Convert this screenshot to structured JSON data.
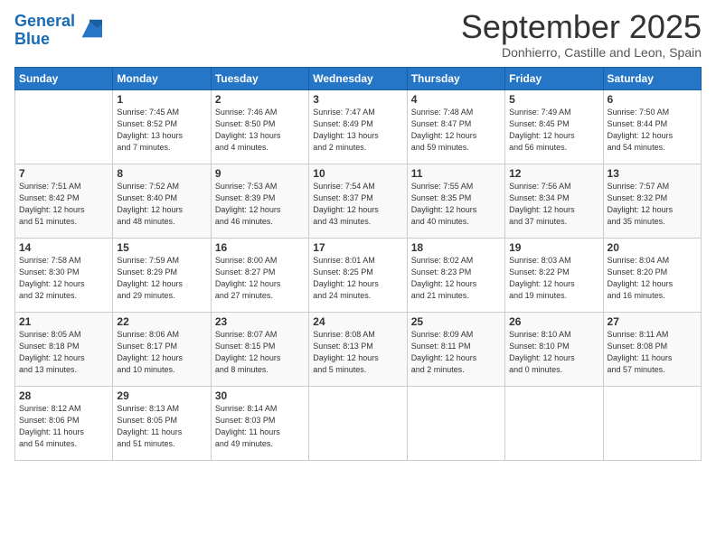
{
  "header": {
    "logo_line1": "General",
    "logo_line2": "Blue",
    "month": "September 2025",
    "location": "Donhierro, Castille and Leon, Spain"
  },
  "days_of_week": [
    "Sunday",
    "Monday",
    "Tuesday",
    "Wednesday",
    "Thursday",
    "Friday",
    "Saturday"
  ],
  "weeks": [
    [
      {
        "day": "",
        "info": ""
      },
      {
        "day": "1",
        "info": "Sunrise: 7:45 AM\nSunset: 8:52 PM\nDaylight: 13 hours\nand 7 minutes."
      },
      {
        "day": "2",
        "info": "Sunrise: 7:46 AM\nSunset: 8:50 PM\nDaylight: 13 hours\nand 4 minutes."
      },
      {
        "day": "3",
        "info": "Sunrise: 7:47 AM\nSunset: 8:49 PM\nDaylight: 13 hours\nand 2 minutes."
      },
      {
        "day": "4",
        "info": "Sunrise: 7:48 AM\nSunset: 8:47 PM\nDaylight: 12 hours\nand 59 minutes."
      },
      {
        "day": "5",
        "info": "Sunrise: 7:49 AM\nSunset: 8:45 PM\nDaylight: 12 hours\nand 56 minutes."
      },
      {
        "day": "6",
        "info": "Sunrise: 7:50 AM\nSunset: 8:44 PM\nDaylight: 12 hours\nand 54 minutes."
      }
    ],
    [
      {
        "day": "7",
        "info": "Sunrise: 7:51 AM\nSunset: 8:42 PM\nDaylight: 12 hours\nand 51 minutes."
      },
      {
        "day": "8",
        "info": "Sunrise: 7:52 AM\nSunset: 8:40 PM\nDaylight: 12 hours\nand 48 minutes."
      },
      {
        "day": "9",
        "info": "Sunrise: 7:53 AM\nSunset: 8:39 PM\nDaylight: 12 hours\nand 46 minutes."
      },
      {
        "day": "10",
        "info": "Sunrise: 7:54 AM\nSunset: 8:37 PM\nDaylight: 12 hours\nand 43 minutes."
      },
      {
        "day": "11",
        "info": "Sunrise: 7:55 AM\nSunset: 8:35 PM\nDaylight: 12 hours\nand 40 minutes."
      },
      {
        "day": "12",
        "info": "Sunrise: 7:56 AM\nSunset: 8:34 PM\nDaylight: 12 hours\nand 37 minutes."
      },
      {
        "day": "13",
        "info": "Sunrise: 7:57 AM\nSunset: 8:32 PM\nDaylight: 12 hours\nand 35 minutes."
      }
    ],
    [
      {
        "day": "14",
        "info": "Sunrise: 7:58 AM\nSunset: 8:30 PM\nDaylight: 12 hours\nand 32 minutes."
      },
      {
        "day": "15",
        "info": "Sunrise: 7:59 AM\nSunset: 8:29 PM\nDaylight: 12 hours\nand 29 minutes."
      },
      {
        "day": "16",
        "info": "Sunrise: 8:00 AM\nSunset: 8:27 PM\nDaylight: 12 hours\nand 27 minutes."
      },
      {
        "day": "17",
        "info": "Sunrise: 8:01 AM\nSunset: 8:25 PM\nDaylight: 12 hours\nand 24 minutes."
      },
      {
        "day": "18",
        "info": "Sunrise: 8:02 AM\nSunset: 8:23 PM\nDaylight: 12 hours\nand 21 minutes."
      },
      {
        "day": "19",
        "info": "Sunrise: 8:03 AM\nSunset: 8:22 PM\nDaylight: 12 hours\nand 19 minutes."
      },
      {
        "day": "20",
        "info": "Sunrise: 8:04 AM\nSunset: 8:20 PM\nDaylight: 12 hours\nand 16 minutes."
      }
    ],
    [
      {
        "day": "21",
        "info": "Sunrise: 8:05 AM\nSunset: 8:18 PM\nDaylight: 12 hours\nand 13 minutes."
      },
      {
        "day": "22",
        "info": "Sunrise: 8:06 AM\nSunset: 8:17 PM\nDaylight: 12 hours\nand 10 minutes."
      },
      {
        "day": "23",
        "info": "Sunrise: 8:07 AM\nSunset: 8:15 PM\nDaylight: 12 hours\nand 8 minutes."
      },
      {
        "day": "24",
        "info": "Sunrise: 8:08 AM\nSunset: 8:13 PM\nDaylight: 12 hours\nand 5 minutes."
      },
      {
        "day": "25",
        "info": "Sunrise: 8:09 AM\nSunset: 8:11 PM\nDaylight: 12 hours\nand 2 minutes."
      },
      {
        "day": "26",
        "info": "Sunrise: 8:10 AM\nSunset: 8:10 PM\nDaylight: 12 hours\nand 0 minutes."
      },
      {
        "day": "27",
        "info": "Sunrise: 8:11 AM\nSunset: 8:08 PM\nDaylight: 11 hours\nand 57 minutes."
      }
    ],
    [
      {
        "day": "28",
        "info": "Sunrise: 8:12 AM\nSunset: 8:06 PM\nDaylight: 11 hours\nand 54 minutes."
      },
      {
        "day": "29",
        "info": "Sunrise: 8:13 AM\nSunset: 8:05 PM\nDaylight: 11 hours\nand 51 minutes."
      },
      {
        "day": "30",
        "info": "Sunrise: 8:14 AM\nSunset: 8:03 PM\nDaylight: 11 hours\nand 49 minutes."
      },
      {
        "day": "",
        "info": ""
      },
      {
        "day": "",
        "info": ""
      },
      {
        "day": "",
        "info": ""
      },
      {
        "day": "",
        "info": ""
      }
    ]
  ]
}
